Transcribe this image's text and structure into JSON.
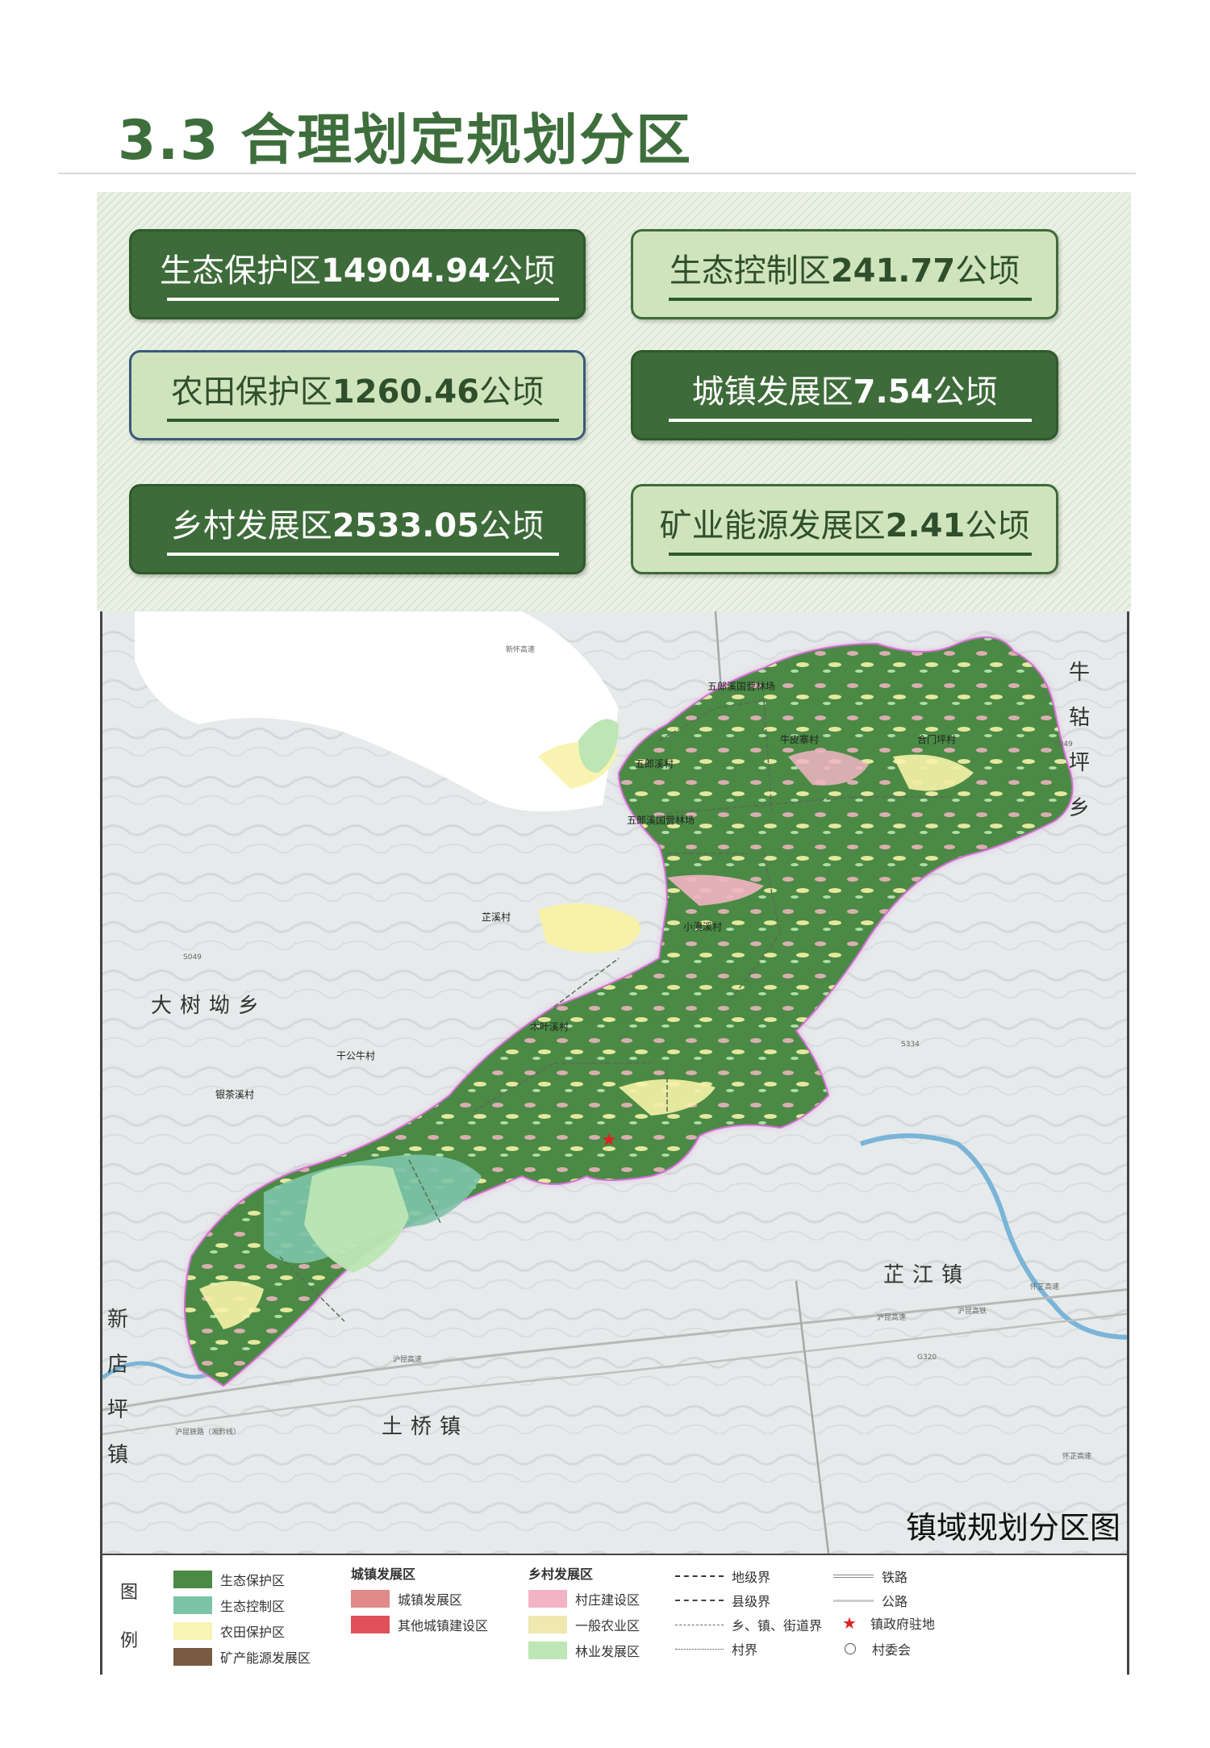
{
  "page": {
    "title": "3.3 合理划定规划分区"
  },
  "zone_stats": [
    {
      "name": "生态保护区",
      "value": "14904.94",
      "unit": "公顷",
      "style": "dark"
    },
    {
      "name": "生态控制区",
      "value": "241.77",
      "unit": "公顷",
      "style": "light"
    },
    {
      "name": "农田保护区",
      "value": "1260.46",
      "unit": "公顷",
      "style": "light"
    },
    {
      "name": "城镇发展区",
      "value": "7.54",
      "unit": "公顷",
      "style": "dark"
    },
    {
      "name": "乡村发展区",
      "value": "2533.05",
      "unit": "公顷",
      "style": "dark"
    },
    {
      "name": "矿业能源发展区",
      "value": "2.41",
      "unit": "公顷",
      "style": "light"
    }
  ],
  "map": {
    "title": "镇域规划分区图",
    "neighbors": {
      "top_right": "牛轱坪乡",
      "left": "大树坳乡",
      "lower_right": "芷江镇",
      "bottom": "土桥镇",
      "lower_left": "新店坪镇"
    },
    "villages": [
      "五郎溪国营林场",
      "牛皮寨村",
      "合门坪村",
      "五郎溪村",
      "五郎溪国营林场",
      "芷溪村",
      "小漫溪村",
      "木叶溪村",
      "干公牛村",
      "银茶溪村"
    ],
    "roads": [
      "S049",
      "S049",
      "S334",
      "G320",
      "沪昆高速",
      "沪昆铁路（湘黔线）",
      "沪昆高铁",
      "怀芷高速",
      "新怀高速",
      "沪昆高速",
      "怀芷高速"
    ],
    "colors": {
      "eco_protection": "#4a8a44",
      "eco_control": "#7cc4a8",
      "farmland": "#f7f2a8",
      "rural_build": "#f2b4c4",
      "general_agri": "#efe8b0",
      "forestry": "#bde6b4",
      "boundary_glow": "#e9a6e6",
      "seat_star": "#e02020"
    }
  },
  "legend": {
    "heading": [
      "图",
      "例"
    ],
    "zones": [
      {
        "label": "生态保护区",
        "color": "#4a8a44"
      },
      {
        "label": "生态控制区",
        "color": "#7cc4a8"
      },
      {
        "label": "农田保护区",
        "color": "#f7f4b4"
      },
      {
        "label": "矿产能源发展区",
        "color": "#7a5a40"
      }
    ],
    "urban_group": {
      "title": "城镇发展区",
      "items": [
        {
          "label": "城镇发展区",
          "color": "#e08a8a"
        },
        {
          "label": "其他城镇建设区",
          "color": "#e0505a"
        }
      ]
    },
    "rural_group": {
      "title": "乡村发展区",
      "items": [
        {
          "label": "村庄建设区",
          "color": "#f2b4c4"
        },
        {
          "label": "一般农业区",
          "color": "#efe8b0"
        },
        {
          "label": "林业发展区",
          "color": "#bde6b4"
        }
      ]
    },
    "boundaries": [
      "地级界",
      "县级界",
      "乡、镇、街道界",
      "村界"
    ],
    "infrastructure": [
      "铁路",
      "公路",
      "镇政府驻地",
      "村委会"
    ]
  }
}
